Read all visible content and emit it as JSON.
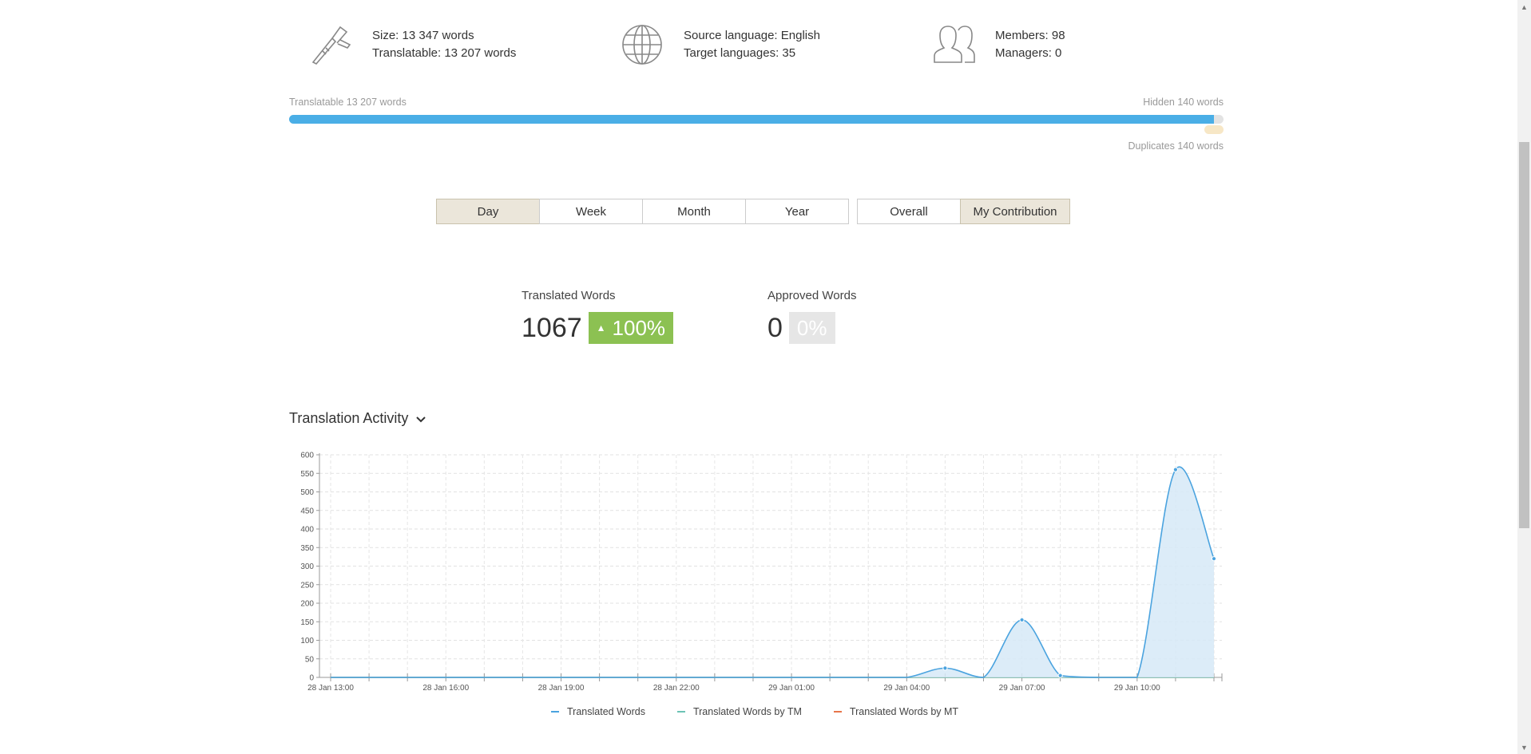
{
  "stats": {
    "size": {
      "icon": "caliper-icon",
      "line1": "Size: 13 347 words",
      "line2": "Translatable: 13 207 words"
    },
    "languages": {
      "icon": "globe-icon",
      "line1": "Source language: English",
      "line2": "Target languages: 35"
    },
    "members": {
      "icon": "users-icon",
      "line1": "Members: 98",
      "line2": "Managers: 0"
    }
  },
  "progress": {
    "translatable_label": "Translatable 13 207 words",
    "hidden_label": "Hidden 140 words",
    "duplicates_label": "Duplicates 140 words",
    "translatable_words": 13207,
    "total_words": 13347,
    "fill_color": "#4aaee6"
  },
  "period_buttons": [
    {
      "label": "Day",
      "active": true
    },
    {
      "label": "Week",
      "active": false
    },
    {
      "label": "Month",
      "active": false
    },
    {
      "label": "Year",
      "active": false
    }
  ],
  "scope_buttons": [
    {
      "label": "Overall",
      "active": false
    },
    {
      "label": "My Contribution",
      "active": true
    }
  ],
  "metrics": {
    "translated": {
      "label": "Translated Words",
      "value": "1067",
      "change": "100%",
      "arrow": "▲"
    },
    "approved": {
      "label": "Approved Words",
      "value": "0",
      "change": "0%"
    }
  },
  "section": {
    "title": "Translation Activity"
  },
  "chart_data": {
    "type": "area",
    "ylim": [
      0,
      600
    ],
    "yticks": [
      0,
      50,
      100,
      150,
      200,
      250,
      300,
      350,
      400,
      450,
      500,
      550,
      600
    ],
    "xtick_labels": [
      "28 Jan 13:00",
      "28 Jan 16:00",
      "28 Jan 19:00",
      "28 Jan 22:00",
      "29 Jan 01:00",
      "29 Jan 04:00",
      "29 Jan 07:00",
      "29 Jan 10:00"
    ],
    "x": [
      "28 Jan 13:00",
      "28 Jan 14:00",
      "28 Jan 15:00",
      "28 Jan 16:00",
      "28 Jan 17:00",
      "28 Jan 18:00",
      "28 Jan 19:00",
      "28 Jan 20:00",
      "28 Jan 21:00",
      "28 Jan 22:00",
      "28 Jan 23:00",
      "29 Jan 00:00",
      "29 Jan 01:00",
      "29 Jan 02:00",
      "29 Jan 03:00",
      "29 Jan 04:00",
      "29 Jan 05:00",
      "29 Jan 06:00",
      "29 Jan 07:00",
      "29 Jan 08:00",
      "29 Jan 09:00",
      "29 Jan 10:00",
      "29 Jan 11:00",
      "29 Jan 12:00"
    ],
    "grid": true,
    "legend_position": "bottom",
    "series": [
      {
        "name": "Translated Words",
        "color": "#4aa3df",
        "values": [
          0,
          0,
          0,
          0,
          0,
          0,
          0,
          0,
          0,
          0,
          0,
          0,
          0,
          0,
          0,
          0,
          25,
          0,
          155,
          5,
          0,
          0,
          560,
          320
        ]
      },
      {
        "name": "Translated Words by TM",
        "color": "#6cc3b5",
        "values": [
          0,
          0,
          0,
          0,
          0,
          0,
          0,
          0,
          0,
          0,
          0,
          0,
          0,
          0,
          0,
          0,
          0,
          0,
          0,
          0,
          0,
          0,
          0,
          0
        ]
      },
      {
        "name": "Translated Words by MT",
        "color": "#e8754a",
        "values": [
          0,
          0,
          0,
          0,
          0,
          0,
          0,
          0,
          0,
          0,
          0,
          0,
          0,
          0,
          0,
          0,
          0,
          0,
          0,
          0,
          0,
          0,
          0,
          0
        ]
      }
    ]
  }
}
